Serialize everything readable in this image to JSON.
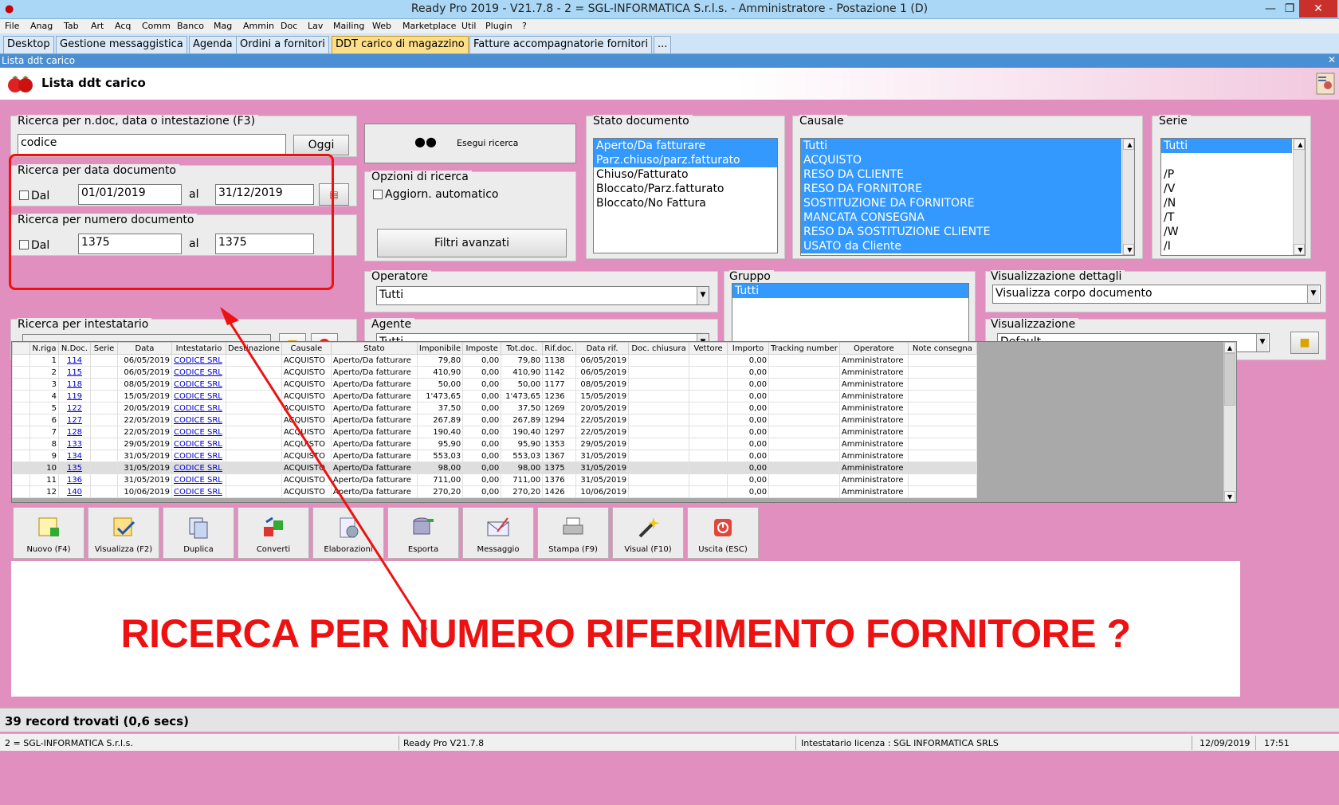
{
  "window": {
    "title": "Ready Pro 2019 - V21.7.8 - 2 = SGL-INFORMATICA S.r.l.s. - Amministratore - Postazione 1 (D)"
  },
  "menu": [
    "File",
    "Anag",
    "Tab",
    "Art",
    "Acq",
    "Comm",
    "Banco",
    "Mag",
    "Ammin",
    "Doc",
    "Lav",
    "Mailing",
    "Web",
    "Marketplace",
    "Util",
    "Plugin",
    "?"
  ],
  "tabs": [
    "Desktop",
    "Gestione messaggistica",
    "Agenda",
    "Ordini a fornitori",
    "DDT carico di magazzino",
    "Fatture accompagnatorie fornitori",
    "..."
  ],
  "subwindow": {
    "caption": "Lista ddt carico",
    "title": "Lista ddt carico"
  },
  "search": {
    "label": "Ricerca per n.doc, data o intestazione (F3)",
    "value": "codice",
    "today_button": "Oggi",
    "run_button": "Esegui ricerca"
  },
  "date_search": {
    "label": "Ricerca per data documento",
    "from_label": "Dal",
    "from": "01/01/2019",
    "to_label": "al",
    "to": "31/12/2019"
  },
  "number_search": {
    "label": "Ricerca per numero documento",
    "from_label": "Dal",
    "from": "1375",
    "to_label": "al",
    "to": "1375"
  },
  "holder_search": {
    "label": "Ricerca per intestatario"
  },
  "options": {
    "label": "Opzioni di ricerca",
    "auto_update": "Aggiorn. automatico",
    "advanced_filters": "Filtri avanzati"
  },
  "status": {
    "label": "Stato documento",
    "items": [
      "Aperto/Da fatturare",
      "Parz.chiuso/parz.fatturato",
      "Chiuso/Fatturato",
      "Bloccato/Parz.fatturato",
      "Bloccato/No Fattura"
    ]
  },
  "causale": {
    "label": "Causale",
    "items": [
      "Tutti",
      "ACQUISTO",
      "RESO DA CLIENTE",
      "RESO DA FORNITORE",
      "SOSTITUZIONE DA FORNITORE",
      "MANCATA CONSEGNA",
      "RESO DA SOSTITUZIONE CLIENTE",
      "USATO da Cliente"
    ]
  },
  "serie": {
    "label": "Serie",
    "items": [
      "Tutti",
      "",
      "/P",
      "/V",
      "/N",
      "/T",
      "/W",
      "/I"
    ]
  },
  "operatore": {
    "label": "Operatore",
    "value": "Tutti"
  },
  "agente": {
    "label": "Agente",
    "value": "Tutti"
  },
  "gruppo": {
    "label": "Gruppo",
    "items": [
      "Tutti"
    ]
  },
  "dettagli": {
    "label": "Visualizzazione dettagli",
    "value": "Visualizza corpo documento"
  },
  "visualizzazione": {
    "label": "Visualizzazione",
    "value": "Default"
  },
  "table": {
    "columns": [
      "N.riga",
      "N.Doc.",
      "Serie",
      "Data",
      "Intestatario",
      "Destinazione",
      "Causale",
      "Stato",
      "Imponibile",
      "Imposte",
      "Tot.doc.",
      "Rif.doc.",
      "Data rif.",
      "Doc. chiusura",
      "Vettore",
      "Importo",
      "Tracking number",
      "Operatore",
      "Note consegna"
    ],
    "rows": [
      [
        "1",
        "114",
        "",
        "06/05/2019",
        "CODICE SRL",
        "",
        "ACQUISTO",
        "Aperto/Da fatturare",
        "79,80",
        "0,00",
        "79,80",
        "1138",
        "06/05/2019",
        "",
        "",
        "0,00",
        "",
        "Amministratore",
        ""
      ],
      [
        "2",
        "115",
        "",
        "06/05/2019",
        "CODICE SRL",
        "",
        "ACQUISTO",
        "Aperto/Da fatturare",
        "410,90",
        "0,00",
        "410,90",
        "1142",
        "06/05/2019",
        "",
        "",
        "0,00",
        "",
        "Amministratore",
        ""
      ],
      [
        "3",
        "118",
        "",
        "08/05/2019",
        "CODICE SRL",
        "",
        "ACQUISTO",
        "Aperto/Da fatturare",
        "50,00",
        "0,00",
        "50,00",
        "1177",
        "08/05/2019",
        "",
        "",
        "0,00",
        "",
        "Amministratore",
        ""
      ],
      [
        "4",
        "119",
        "",
        "15/05/2019",
        "CODICE SRL",
        "",
        "ACQUISTO",
        "Aperto/Da fatturare",
        "1'473,65",
        "0,00",
        "1'473,65",
        "1236",
        "15/05/2019",
        "",
        "",
        "0,00",
        "",
        "Amministratore",
        ""
      ],
      [
        "5",
        "122",
        "",
        "20/05/2019",
        "CODICE SRL",
        "",
        "ACQUISTO",
        "Aperto/Da fatturare",
        "37,50",
        "0,00",
        "37,50",
        "1269",
        "20/05/2019",
        "",
        "",
        "0,00",
        "",
        "Amministratore",
        ""
      ],
      [
        "6",
        "127",
        "",
        "22/05/2019",
        "CODICE SRL",
        "",
        "ACQUISTO",
        "Aperto/Da fatturare",
        "267,89",
        "0,00",
        "267,89",
        "1294",
        "22/05/2019",
        "",
        "",
        "0,00",
        "",
        "Amministratore",
        ""
      ],
      [
        "7",
        "128",
        "",
        "22/05/2019",
        "CODICE SRL",
        "",
        "ACQUISTO",
        "Aperto/Da fatturare",
        "190,40",
        "0,00",
        "190,40",
        "1297",
        "22/05/2019",
        "",
        "",
        "0,00",
        "",
        "Amministratore",
        ""
      ],
      [
        "8",
        "133",
        "",
        "29/05/2019",
        "CODICE SRL",
        "",
        "ACQUISTO",
        "Aperto/Da fatturare",
        "95,90",
        "0,00",
        "95,90",
        "1353",
        "29/05/2019",
        "",
        "",
        "0,00",
        "",
        "Amministratore",
        ""
      ],
      [
        "9",
        "134",
        "",
        "31/05/2019",
        "CODICE SRL",
        "",
        "ACQUISTO",
        "Aperto/Da fatturare",
        "553,03",
        "0,00",
        "553,03",
        "1367",
        "31/05/2019",
        "",
        "",
        "0,00",
        "",
        "Amministratore",
        ""
      ],
      [
        "10",
        "135",
        "",
        "31/05/2019",
        "CODICE SRL",
        "",
        "ACQUISTO",
        "Aperto/Da fatturare",
        "98,00",
        "0,00",
        "98,00",
        "1375",
        "31/05/2019",
        "",
        "",
        "0,00",
        "",
        "Amministratore",
        ""
      ],
      [
        "11",
        "136",
        "",
        "31/05/2019",
        "CODICE SRL",
        "",
        "ACQUISTO",
        "Aperto/Da fatturare",
        "711,00",
        "0,00",
        "711,00",
        "1376",
        "31/05/2019",
        "",
        "",
        "0,00",
        "",
        "Amministratore",
        ""
      ],
      [
        "12",
        "140",
        "",
        "10/06/2019",
        "CODICE SRL",
        "",
        "ACQUISTO",
        "Aperto/Da fatturare",
        "270,20",
        "0,00",
        "270,20",
        "1426",
        "10/06/2019",
        "",
        "",
        "0,00",
        "",
        "Amministratore",
        ""
      ]
    ]
  },
  "toolbar": [
    "Nuovo (F4)",
    "Visualizza (F2)",
    "Duplica",
    "Converti",
    "Elaborazioni",
    "Esporta",
    "Messaggio",
    "Stampa (F9)",
    "Visual (F10)",
    "Uscita (ESC)"
  ],
  "annotation": {
    "text": "RICERCA PER NUMERO RIFERIMENTO FORNITORE ?",
    "color": "#ee1111"
  },
  "records": "39 record trovati (0,6 secs)",
  "statusbar": {
    "company": "2 = SGL-INFORMATICA S.r.l.s.",
    "version": "Ready Pro V21.7.8",
    "license": "Intestatario licenza : SGL INFORMATICA SRLS",
    "date": "12/09/2019",
    "time": "17:51"
  }
}
